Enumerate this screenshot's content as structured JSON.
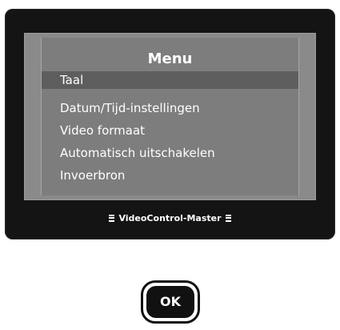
{
  "menu": {
    "title": "Menu",
    "items": [
      {
        "label": "Taal",
        "selected": true
      },
      {
        "label": "Datum/Tijd-instellingen",
        "selected": false
      },
      {
        "label": "Video formaat",
        "selected": false
      },
      {
        "label": "Automatisch uitschakelen",
        "selected": false
      },
      {
        "label": "Invoerbron",
        "selected": false
      }
    ]
  },
  "device": {
    "brand": "VideoControl-Master"
  },
  "controls": {
    "ok_label": "OK"
  },
  "colors": {
    "housing": "#141414",
    "screen": "#7d7d7d",
    "highlight": "#5e5e5e",
    "text": "#ffffff"
  }
}
